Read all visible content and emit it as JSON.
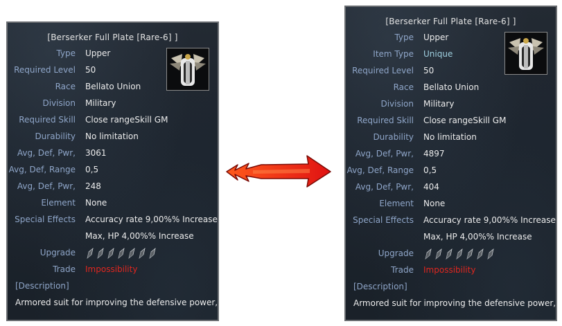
{
  "left": {
    "title": "[Berserker Full Plate [Rare-6] ]",
    "rows": [
      {
        "label": "Type",
        "value": "Upper"
      },
      {
        "label": "Required Level",
        "value": "50"
      },
      {
        "label": "Race",
        "value": "Bellato Union"
      },
      {
        "label": "Division",
        "value": "Military"
      },
      {
        "label": "Required Skill",
        "value": "Close rangeSkill GM"
      },
      {
        "label": "Durability",
        "value": "No limitation"
      },
      {
        "label": "Avg, Def, Pwr,",
        "value": "3061"
      },
      {
        "label": "Avg, Def, Range",
        "value": "0,5"
      },
      {
        "label": "Avg, Def, Pwr,",
        "value": "248"
      },
      {
        "label": "Element",
        "value": "None"
      },
      {
        "label": "Special Effects",
        "value": "Accuracy rate 9,00%% Increase"
      },
      {
        "label": "",
        "value": "Max, HP 4,00%% Increase"
      }
    ],
    "upgrade_label": "Upgrade",
    "trade_label": "Trade",
    "trade_value": "Impossibility",
    "description_header": "[Description]",
    "description": "Armored suit for improving the defensive power,"
  },
  "right": {
    "title": "[Berserker Full Plate [Rare-6] ]",
    "rows": [
      {
        "label": "Type",
        "value": "Upper"
      },
      {
        "label": "Item Type",
        "value": "Unique"
      },
      {
        "label": "Required Level",
        "value": "50"
      },
      {
        "label": "Race",
        "value": "Bellato Union"
      },
      {
        "label": "Division",
        "value": "Military"
      },
      {
        "label": "Required Skill",
        "value": "Close rangeSkill GM"
      },
      {
        "label": "Durability",
        "value": "No limitation"
      },
      {
        "label": "Avg, Def, Pwr,",
        "value": "4897"
      },
      {
        "label": "Avg, Def, Range",
        "value": "0,5"
      },
      {
        "label": "Avg, Def, Pwr,",
        "value": "404"
      },
      {
        "label": "Element",
        "value": "None"
      },
      {
        "label": "Special Effects",
        "value": "Accuracy rate 9,00%% Increase"
      },
      {
        "label": "",
        "value": "Max, HP 4,00%% Increase"
      }
    ],
    "upgrade_label": "Upgrade",
    "trade_label": "Trade",
    "trade_value": "Impossibility",
    "description_header": "[Description]",
    "description": "Armored suit for improving the defensive power,"
  },
  "upgrade_slots": 7,
  "icons": {
    "item": "armor-icon",
    "gem": "talic-gem-icon",
    "arrow": "arrow-icon"
  },
  "colors": {
    "label": "#8fa6c9",
    "value": "#ececec",
    "unique": "#9fd0e0",
    "trade": "#e0261f",
    "arrow": "#e8321c"
  }
}
